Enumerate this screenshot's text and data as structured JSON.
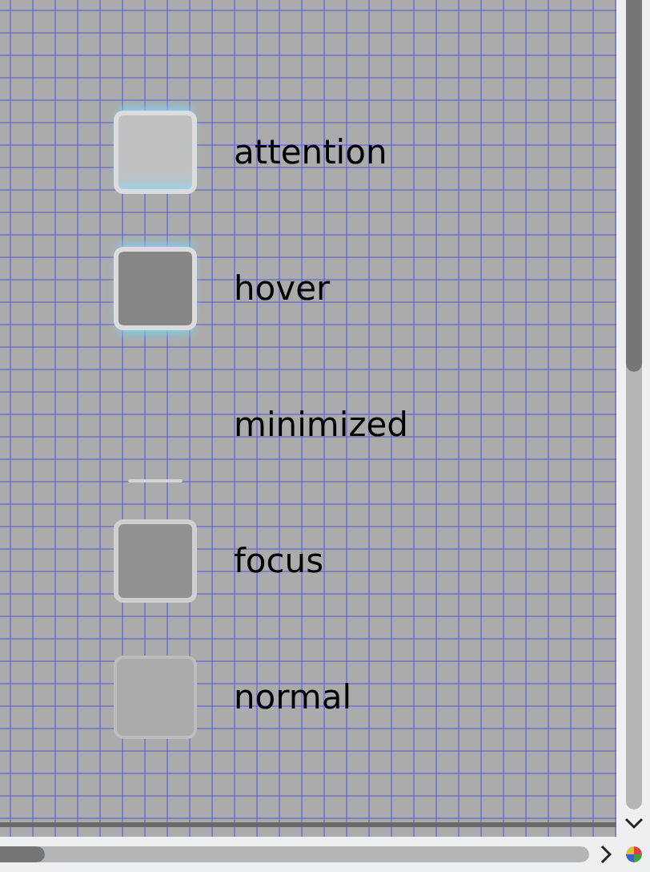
{
  "items": [
    {
      "label": "attention",
      "kind": "attention"
    },
    {
      "label": "hover",
      "kind": "hover"
    },
    {
      "label": "minimized",
      "kind": "minimized"
    },
    {
      "label": "focus",
      "kind": "focus"
    },
    {
      "label": "normal",
      "kind": "normal"
    }
  ]
}
